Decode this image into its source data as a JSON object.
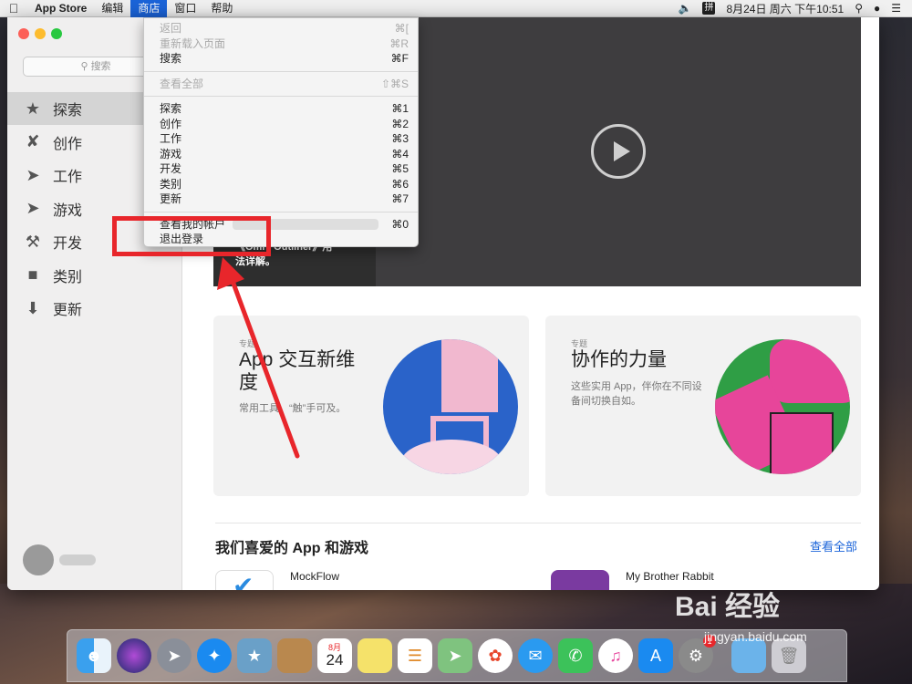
{
  "menubar": {
    "apple_icon": "apple-logo-icon",
    "items": [
      {
        "label": "App Store",
        "bold": true
      },
      {
        "label": "编辑"
      },
      {
        "label": "商店",
        "active": true
      },
      {
        "label": "窗口"
      },
      {
        "label": "帮助"
      }
    ],
    "ime_label": "拼",
    "clock": "8月24日 周六 下午10:51"
  },
  "dropdown": {
    "groups": [
      [
        {
          "label": "返回",
          "shortcut": "⌘[",
          "disabled": true
        },
        {
          "label": "重新载入页面",
          "shortcut": "⌘R",
          "disabled": true
        },
        {
          "label": "搜索",
          "shortcut": "⌘F"
        }
      ],
      [
        {
          "label": "查看全部",
          "shortcut": "⇧⌘S",
          "disabled": true
        }
      ],
      [
        {
          "label": "探索",
          "shortcut": "⌘1"
        },
        {
          "label": "创作",
          "shortcut": "⌘2"
        },
        {
          "label": "工作",
          "shortcut": "⌘3"
        },
        {
          "label": "游戏",
          "shortcut": "⌘4"
        },
        {
          "label": "开发",
          "shortcut": "⌘5"
        },
        {
          "label": "类别",
          "shortcut": "⌘6"
        },
        {
          "label": "更新",
          "shortcut": "⌘7"
        }
      ],
      [
        {
          "label": "查看我的帐户",
          "shortcut": "⌘0"
        },
        {
          "label": "退出登录",
          "shortcut": ""
        }
      ]
    ]
  },
  "sidebar": {
    "search_placeholder": "搜索",
    "items": [
      {
        "label": "探索",
        "icon": "star-icon",
        "selected": true
      },
      {
        "label": "创作",
        "icon": "hammer-brush-icon"
      },
      {
        "label": "工作",
        "icon": "paper-plane-icon"
      },
      {
        "label": "游戏",
        "icon": "rocket-icon"
      },
      {
        "label": "开发",
        "icon": "hammer-icon"
      },
      {
        "label": "类别",
        "icon": "stack-icon"
      },
      {
        "label": "更新",
        "icon": "download-icon"
      }
    ]
  },
  "hero": {
    "text_line1": "《Omni Outliner》用",
    "text_line2": "法详解。"
  },
  "cards": [
    {
      "eyebrow": "专题",
      "title": "App 交互新维度",
      "subtitle": "常用工具，“触”手可及。"
    },
    {
      "eyebrow": "专题",
      "title": "协作的力量",
      "subtitle": "这些实用 App，伴你在不同设备间切换自如。"
    }
  ],
  "section": {
    "title": "我们喜爱的 App 和游戏",
    "see_all": "查看全部",
    "apps": [
      {
        "name": "MockFlow"
      },
      {
        "name": "My Brother Rabbit"
      }
    ]
  },
  "dock": {
    "icons": [
      "finder-icon",
      "siri-icon",
      "launchpad-icon",
      "safari-icon",
      "preview-icon",
      "notes-book-icon",
      "calendar-icon",
      "stickies-icon",
      "reminders-icon",
      "maps-icon",
      "photos-icon",
      "messages-icon",
      "facetime-icon",
      "itunes-icon",
      "appstore-icon",
      "system-preferences-icon",
      "folder-icon",
      "trash-icon"
    ],
    "calendar_month": "8月",
    "calendar_day": "24",
    "badge": "1"
  },
  "watermark": {
    "brand": "Bai 经验",
    "url": "jingyan.baidu.com"
  },
  "colors": {
    "accent": "#1b64d9",
    "annotation": "#e8262b"
  }
}
